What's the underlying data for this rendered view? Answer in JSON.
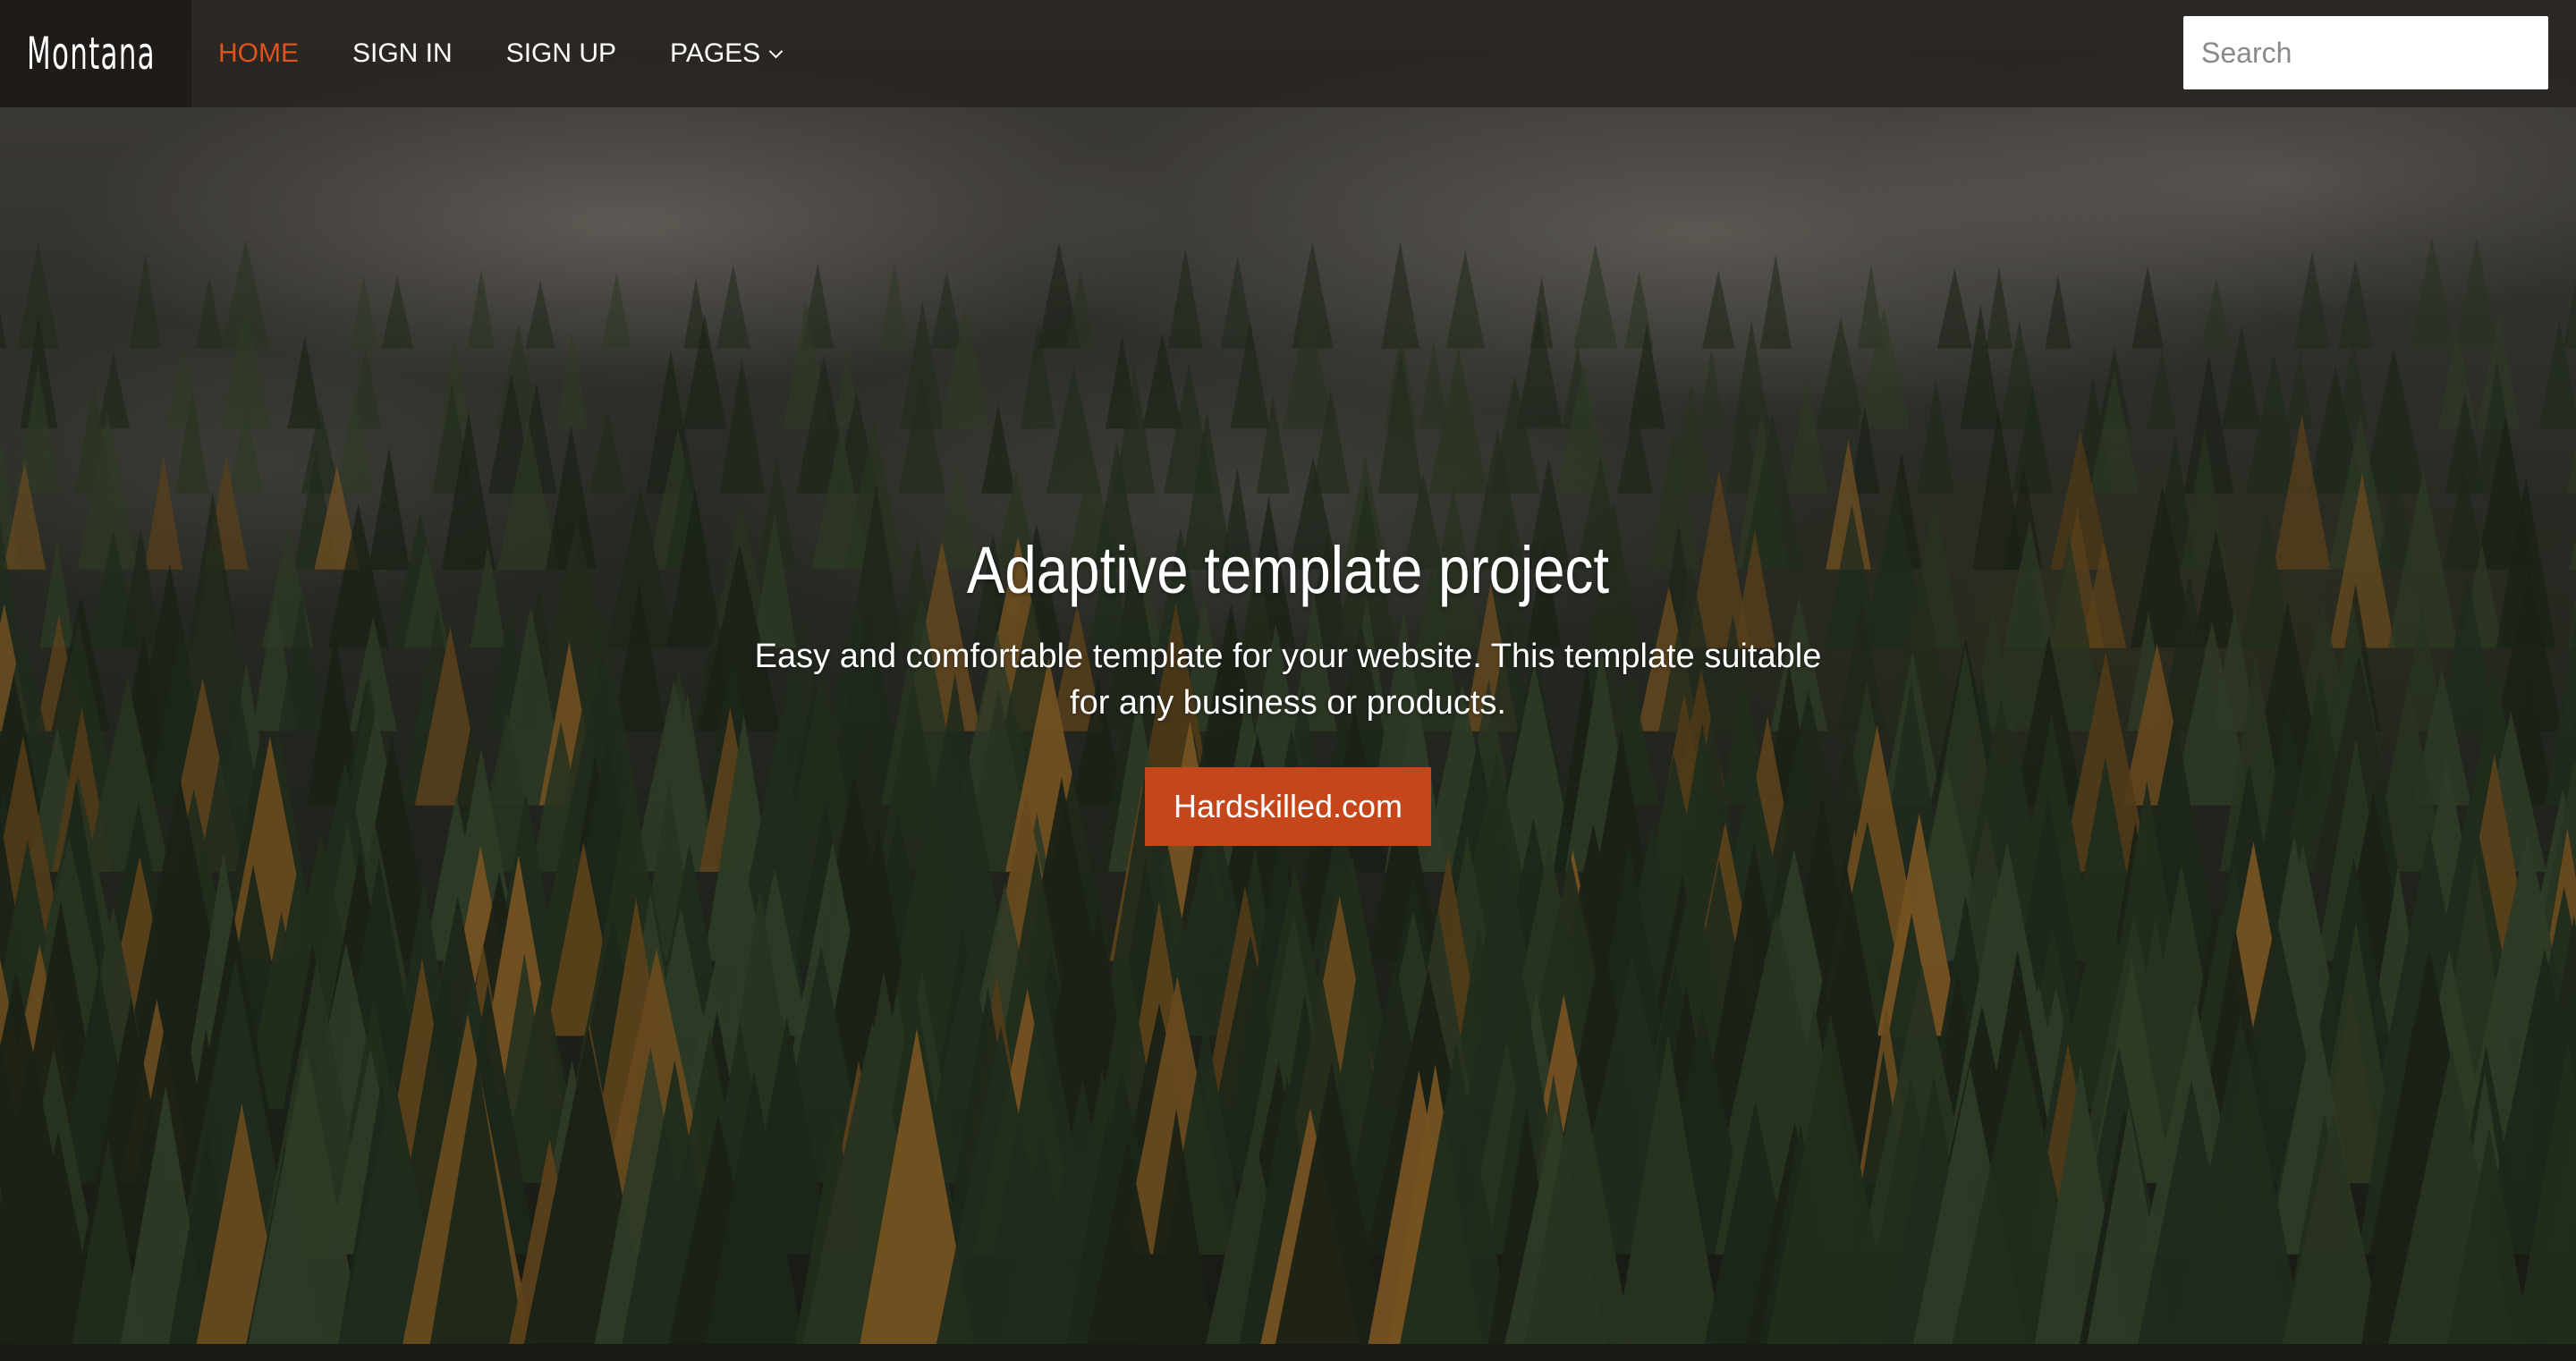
{
  "brand": {
    "name": "Montana"
  },
  "nav": {
    "items": [
      {
        "label": "HOME",
        "active": true
      },
      {
        "label": "SIGN IN",
        "active": false
      },
      {
        "label": "SIGN UP",
        "active": false
      },
      {
        "label": "PAGES",
        "active": false,
        "has_dropdown": true
      }
    ]
  },
  "search": {
    "placeholder": "Search",
    "value": "",
    "icon": "search-icon"
  },
  "hero": {
    "title": "Adaptive template project",
    "subtitle": "Easy and comfortable template for your website. This template suitable for any business or products.",
    "button_label": "Hardskilled.com"
  },
  "colors": {
    "accent": "#e0531d",
    "button": "#c4461a",
    "navbar": "#2b2623"
  }
}
